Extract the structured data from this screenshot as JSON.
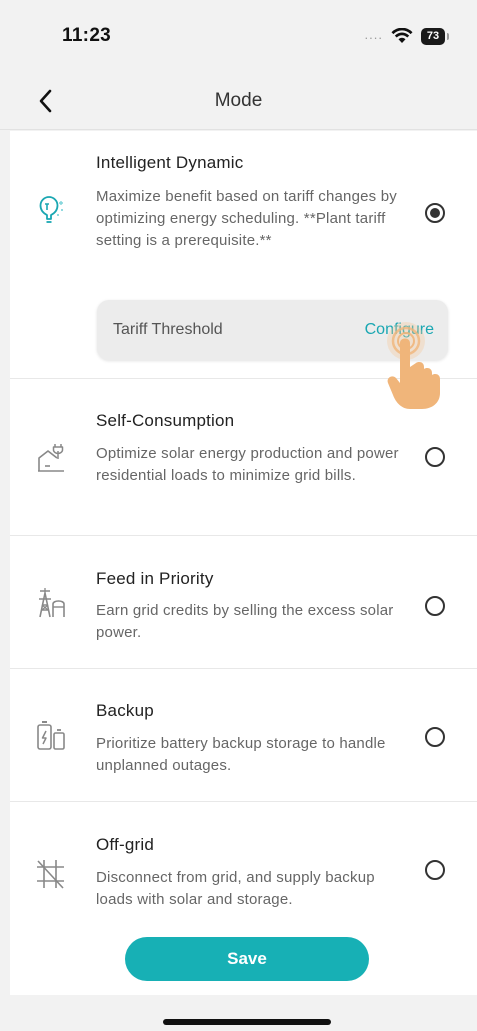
{
  "status_bar": {
    "time": "11:23",
    "cell": "....",
    "battery": "73"
  },
  "nav": {
    "title": "Mode"
  },
  "modes": [
    {
      "title": "Intelligent Dynamic",
      "description": "Maximize benefit based on tariff changes by optimizing energy scheduling. **Plant tariff setting is a prerequisite.**",
      "selected": true,
      "icon": "lightbulb-icon"
    },
    {
      "title": "Self-Consumption",
      "description": "Optimize solar energy production and power residential loads to minimize grid bills.",
      "selected": false,
      "icon": "house-plug-icon"
    },
    {
      "title": "Feed in Priority",
      "description": "Earn grid credits by selling the excess solar power.",
      "selected": false,
      "icon": "transmission-tower-icon"
    },
    {
      "title": "Backup",
      "description": "Prioritize battery backup storage to handle unplanned outages.",
      "selected": false,
      "icon": "battery-icon"
    },
    {
      "title": "Off-grid",
      "description": "Disconnect from grid, and supply backup loads with solar and storage.",
      "selected": false,
      "icon": "grid-off-icon"
    }
  ],
  "tariff": {
    "label": "Tariff Threshold",
    "action": "Configure"
  },
  "save_label": "Save",
  "colors": {
    "accent": "#17b0b5",
    "icon_teal": "#1aa7b2",
    "hand": "#f0b57a"
  }
}
